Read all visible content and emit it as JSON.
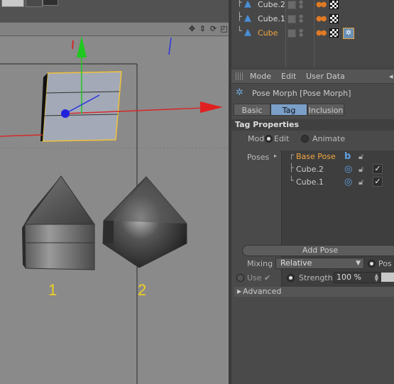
{
  "viewport": {
    "nav_icons": [
      "move-icon",
      "arrows-icon",
      "rotate-icon",
      "maximize-icon"
    ],
    "object_labels": [
      "1",
      "2"
    ],
    "label_color": "#f0d020",
    "axis_colors": {
      "x": "#d42a2a",
      "y": "#1ec81e",
      "z": "#2a36e0"
    }
  },
  "object_manager": {
    "rows": [
      {
        "name": "Cube.2",
        "selected": false
      },
      {
        "name": "Cube.1",
        "selected": false
      },
      {
        "name": "Cube",
        "selected": true
      }
    ]
  },
  "attributes": {
    "menu": [
      "Mode",
      "Edit",
      "User Data"
    ],
    "title": "Pose Morph [Pose Morph]",
    "tabs": [
      {
        "label": "Basic",
        "active": false
      },
      {
        "label": "Tag",
        "active": true
      },
      {
        "label": "Inclusion",
        "active": false
      }
    ],
    "section_title": "Tag Properties",
    "mode_label": "Mode",
    "mode_options": [
      {
        "label": "Edit",
        "selected": true
      },
      {
        "label": "Animate",
        "selected": false
      }
    ],
    "poses_label": "Poses",
    "poses": [
      {
        "name": "Base Pose",
        "base": true
      },
      {
        "name": "Cube.2",
        "base": false
      },
      {
        "name": "Cube.1",
        "base": false
      }
    ],
    "add_pose_label": "Add Pose",
    "mixing_label": "Mixing",
    "mixing_value": "Relative",
    "pos_label": "Pos",
    "use_label": "Use",
    "strength_label": "Strength",
    "strength_value": "100 %",
    "strength_fraction": 1.0,
    "advanced_label": "Advanced"
  },
  "colors": {
    "accent": "#f3a640",
    "tab_active": "#7a9fc8",
    "viewport_bg": "#8a8a8a"
  }
}
